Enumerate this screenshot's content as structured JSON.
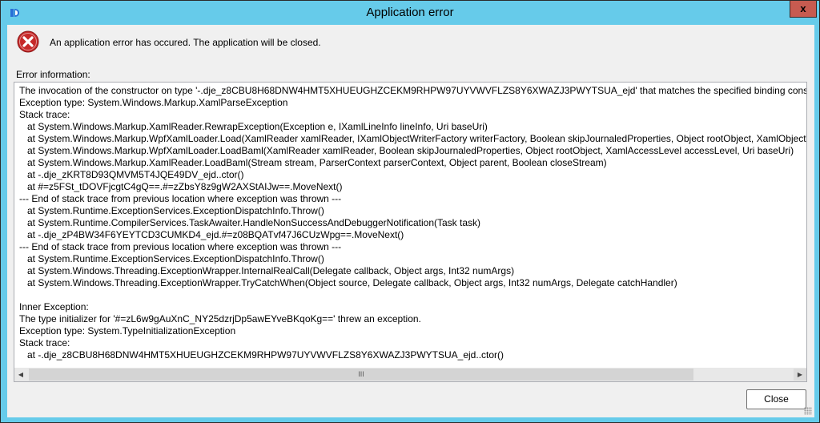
{
  "window": {
    "title": "Application error",
    "close_glyph": "x"
  },
  "message": "An application error has occured. The application will be closed.",
  "info_label": "Error information:",
  "error_lines": [
    "The invocation of the constructor on type '-.dje_z8CBU8H68DNW4HMT5XHUEUGHZCEKM9RHPW97UYVWVFLZS8Y6XWAZJ3PWYTSUA_ejd' that matches the specified binding constraints",
    "Exception type: System.Windows.Markup.XamlParseException",
    "Stack trace:",
    "   at System.Windows.Markup.XamlReader.RewrapException(Exception e, IXamlLineInfo lineInfo, Uri baseUri)",
    "   at System.Windows.Markup.WpfXamlLoader.Load(XamlReader xamlReader, IXamlObjectWriterFactory writerFactory, Boolean skipJournaledProperties, Object rootObject, XamlObjectWrit",
    "   at System.Windows.Markup.WpfXamlLoader.LoadBaml(XamlReader xamlReader, Boolean skipJournaledProperties, Object rootObject, XamlAccessLevel accessLevel, Uri baseUri)",
    "   at System.Windows.Markup.XamlReader.LoadBaml(Stream stream, ParserContext parserContext, Object parent, Boolean closeStream)",
    "   at -.dje_zKRT8D93QMVM5T4JQE49DV_ejd..ctor()",
    "   at #=z5FSt_tDOVFjcgtC4gQ==.#=zZbsY8z9gW2AXStAIJw==.MoveNext()",
    "--- End of stack trace from previous location where exception was thrown ---",
    "   at System.Runtime.ExceptionServices.ExceptionDispatchInfo.Throw()",
    "   at System.Runtime.CompilerServices.TaskAwaiter.HandleNonSuccessAndDebuggerNotification(Task task)",
    "   at -.dje_zP4BW34F6YEYTCD3CUMKD4_ejd.#=z08BQATvf47J6CUzWpg==.MoveNext()",
    "--- End of stack trace from previous location where exception was thrown ---",
    "   at System.Runtime.ExceptionServices.ExceptionDispatchInfo.Throw()",
    "   at System.Windows.Threading.ExceptionWrapper.InternalRealCall(Delegate callback, Object args, Int32 numArgs)",
    "   at System.Windows.Threading.ExceptionWrapper.TryCatchWhen(Object source, Delegate callback, Object args, Int32 numArgs, Delegate catchHandler)",
    "",
    "Inner Exception:",
    "The type initializer for '#=zL6w9gAuXnC_NY25dzrjDp5awEYveBKqoKg==' threw an exception.",
    "Exception type: System.TypeInitializationException",
    "Stack trace:",
    "   at -.dje_z8CBU8H68DNW4HMT5XHUEUGHZCEKM9RHPW97UYVWVFLZS8Y6XWAZJ3PWYTSUA_ejd..ctor()"
  ],
  "scrollbar": {
    "left_arrow": "◀",
    "right_arrow": "▶",
    "thumb_grip": "III"
  },
  "close_button": "Close",
  "colors": {
    "titlebar": "#66cbea",
    "close_button": "#c75b50",
    "error_icon": "#c62828"
  }
}
